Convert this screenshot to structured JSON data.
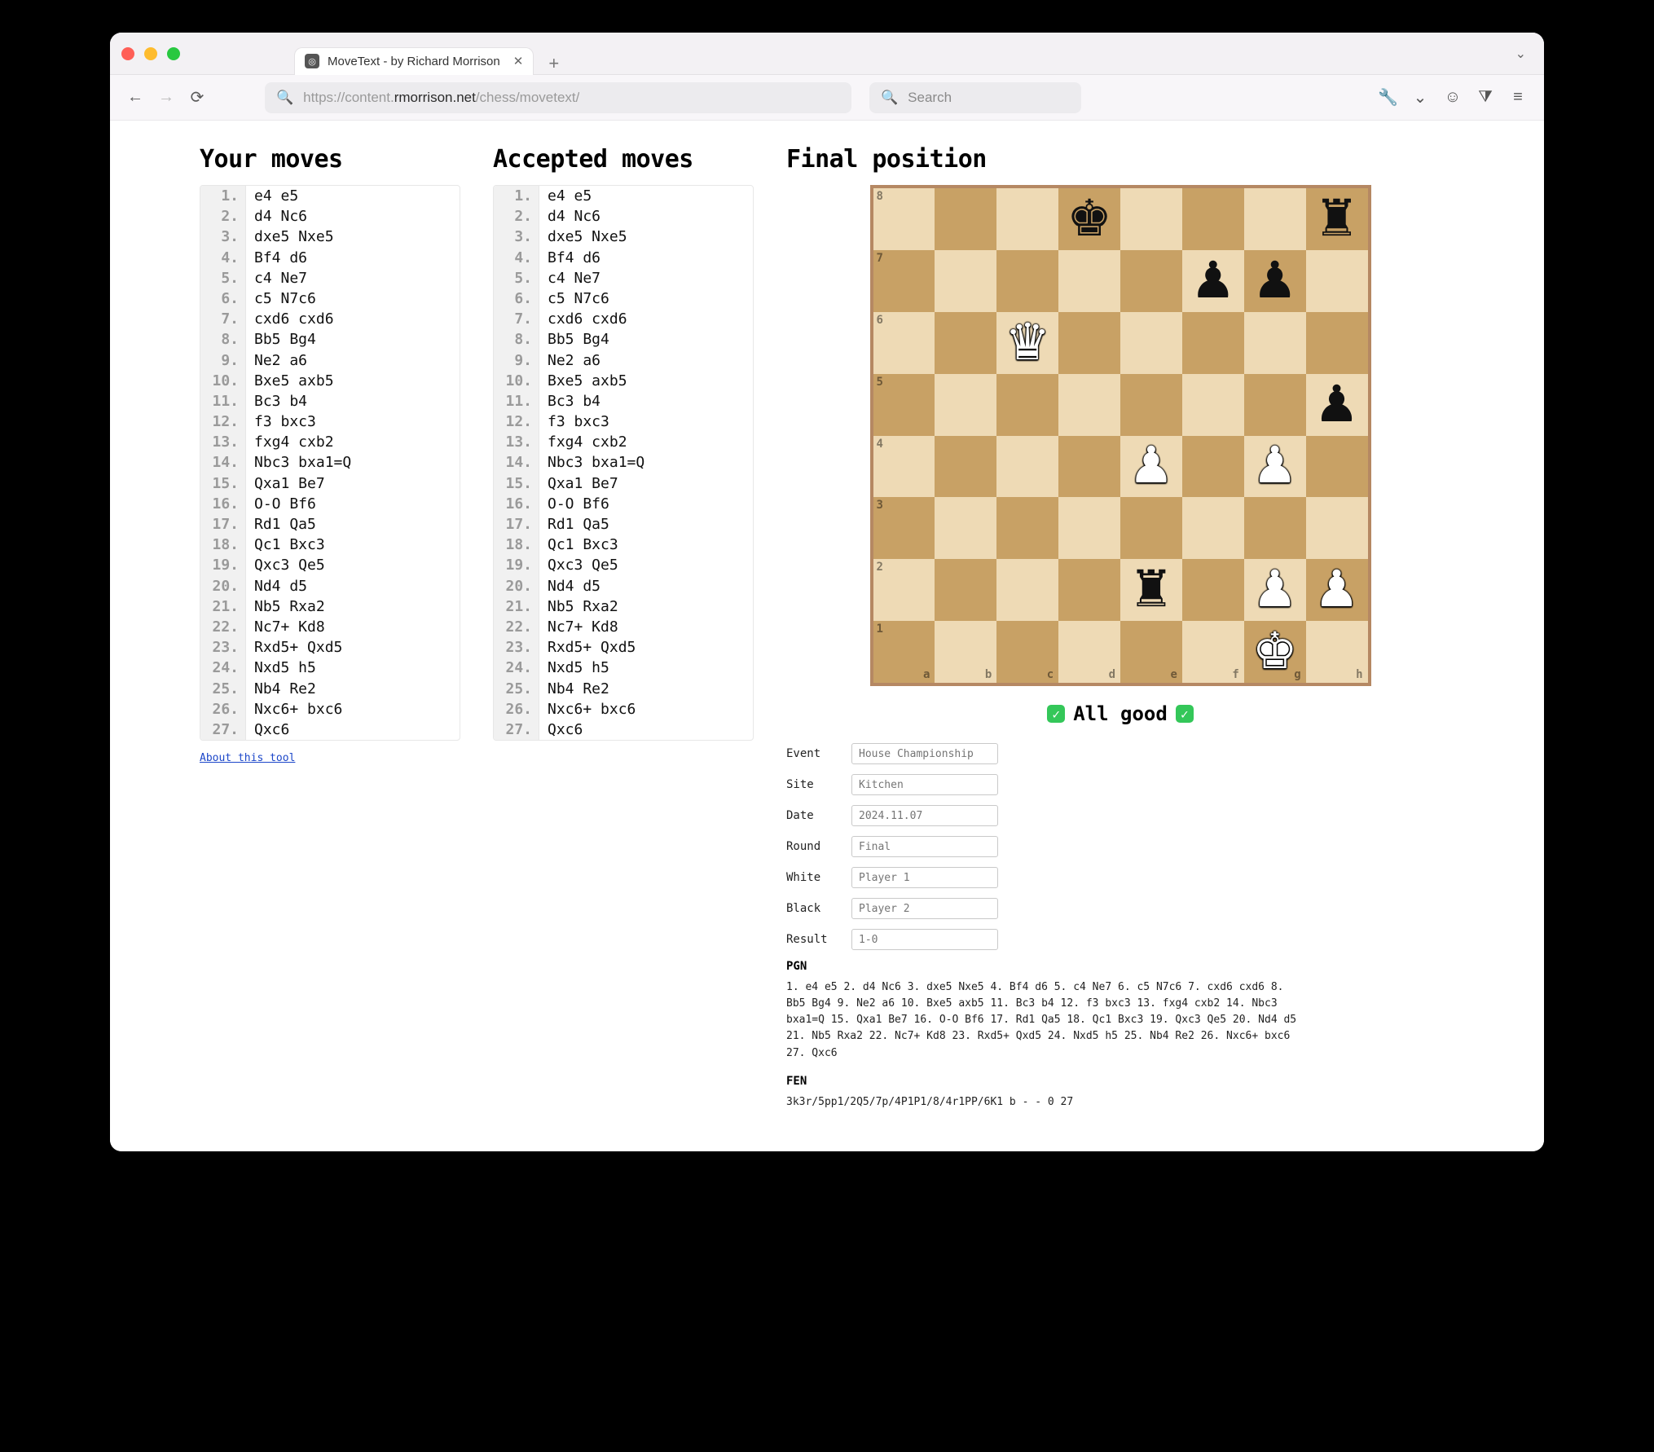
{
  "window": {
    "tab_title": "MoveText - by Richard Morrison",
    "url_grey_prefix": "https://content.",
    "url_dark": "rmorrison.net",
    "url_grey_suffix": "/chess/movetext/",
    "search_placeholder": "Search"
  },
  "headings": {
    "your_moves": "Your moves",
    "accepted_moves": "Accepted moves",
    "final_position": "Final position"
  },
  "moves": [
    {
      "n": "1.",
      "t": "e4 e5"
    },
    {
      "n": "2.",
      "t": "d4 Nc6"
    },
    {
      "n": "3.",
      "t": "dxe5 Nxe5"
    },
    {
      "n": "4.",
      "t": "Bf4 d6"
    },
    {
      "n": "5.",
      "t": "c4 Ne7"
    },
    {
      "n": "6.",
      "t": "c5 N7c6"
    },
    {
      "n": "7.",
      "t": "cxd6 cxd6"
    },
    {
      "n": "8.",
      "t": "Bb5 Bg4"
    },
    {
      "n": "9.",
      "t": "Ne2 a6"
    },
    {
      "n": "10.",
      "t": "Bxe5 axb5"
    },
    {
      "n": "11.",
      "t": "Bc3 b4"
    },
    {
      "n": "12.",
      "t": "f3 bxc3"
    },
    {
      "n": "13.",
      "t": "fxg4 cxb2"
    },
    {
      "n": "14.",
      "t": "Nbc3 bxa1=Q"
    },
    {
      "n": "15.",
      "t": "Qxa1 Be7"
    },
    {
      "n": "16.",
      "t": "O-O Bf6"
    },
    {
      "n": "17.",
      "t": "Rd1 Qa5"
    },
    {
      "n": "18.",
      "t": "Qc1 Bxc3"
    },
    {
      "n": "19.",
      "t": "Qxc3 Qe5"
    },
    {
      "n": "20.",
      "t": "Nd4 d5"
    },
    {
      "n": "21.",
      "t": "Nb5 Rxa2"
    },
    {
      "n": "22.",
      "t": "Nc7+ Kd8"
    },
    {
      "n": "23.",
      "t": "Rxd5+ Qxd5"
    },
    {
      "n": "24.",
      "t": "Nxd5 h5"
    },
    {
      "n": "25.",
      "t": "Nb4 Re2"
    },
    {
      "n": "26.",
      "t": "Nxc6+ bxc6"
    },
    {
      "n": "27.",
      "t": "Qxc6"
    }
  ],
  "about_link": "About this tool",
  "status": "All good",
  "meta_labels": {
    "event": "Event",
    "site": "Site",
    "date": "Date",
    "round": "Round",
    "white": "White",
    "black": "Black",
    "result": "Result"
  },
  "meta_placeholders": {
    "event": "House Championship",
    "site": "Kitchen",
    "date": "2024.11.07",
    "round": "Final",
    "white": "Player 1",
    "black": "Player 2",
    "result": "1-0"
  },
  "pgn_label": "PGN",
  "pgn_text": "1. e4 e5 2. d4 Nc6 3. dxe5 Nxe5 4. Bf4 d6 5. c4 Ne7 6. c5 N7c6 7. cxd6 cxd6 8. Bb5 Bg4 9. Ne2 a6 10. Bxe5 axb5 11. Bc3 b4 12. f3 bxc3 13. fxg4 cxb2 14. Nbc3 bxa1=Q 15. Qxa1 Be7 16. O-O Bf6 17. Rd1 Qa5 18. Qc1 Bxc3 19. Qxc3 Qe5 20. Nd4 d5 21. Nb5 Rxa2 22. Nc7+ Kd8 23. Rxd5+ Qxd5 24. Nxd5 h5 25. Nb4 Re2 26. Nxc6+ bxc6 27. Qxc6",
  "fen_label": "FEN",
  "fen_text": "3k3r/5pp1/2Q5/7p/4P1P1/8/4r1PP/6K1 b - - 0 27",
  "board": {
    "files": [
      "a",
      "b",
      "c",
      "d",
      "e",
      "f",
      "g",
      "h"
    ],
    "ranks": [
      "8",
      "7",
      "6",
      "5",
      "4",
      "3",
      "2",
      "1"
    ],
    "pieces": [
      {
        "sq": "d8",
        "color": "b",
        "glyph": "♚"
      },
      {
        "sq": "h8",
        "color": "b",
        "glyph": "♜"
      },
      {
        "sq": "f7",
        "color": "b",
        "glyph": "♟"
      },
      {
        "sq": "g7",
        "color": "b",
        "glyph": "♟"
      },
      {
        "sq": "c6",
        "color": "w",
        "glyph": "♛"
      },
      {
        "sq": "h5",
        "color": "b",
        "glyph": "♟"
      },
      {
        "sq": "e4",
        "color": "w",
        "glyph": "♟"
      },
      {
        "sq": "g4",
        "color": "w",
        "glyph": "♟"
      },
      {
        "sq": "e2",
        "color": "b",
        "glyph": "♜"
      },
      {
        "sq": "g2",
        "color": "w",
        "glyph": "♟"
      },
      {
        "sq": "h2",
        "color": "w",
        "glyph": "♟"
      },
      {
        "sq": "g1",
        "color": "w",
        "glyph": "♚"
      }
    ]
  },
  "chart_data": {
    "type": "table",
    "title": "Chess game final position",
    "fen": "3k3r/5pp1/2Q5/7p/4P1P1/8/4r1PP/6K1 b - - 0 27",
    "side_to_move": "black",
    "fullmove": 27,
    "pieces": [
      {
        "square": "d8",
        "piece": "king",
        "color": "black"
      },
      {
        "square": "h8",
        "piece": "rook",
        "color": "black"
      },
      {
        "square": "f7",
        "piece": "pawn",
        "color": "black"
      },
      {
        "square": "g7",
        "piece": "pawn",
        "color": "black"
      },
      {
        "square": "c6",
        "piece": "queen",
        "color": "white"
      },
      {
        "square": "h5",
        "piece": "pawn",
        "color": "black"
      },
      {
        "square": "e4",
        "piece": "pawn",
        "color": "white"
      },
      {
        "square": "g4",
        "piece": "pawn",
        "color": "white"
      },
      {
        "square": "e2",
        "piece": "rook",
        "color": "black"
      },
      {
        "square": "g2",
        "piece": "pawn",
        "color": "white"
      },
      {
        "square": "h2",
        "piece": "pawn",
        "color": "white"
      },
      {
        "square": "g1",
        "piece": "king",
        "color": "white"
      }
    ]
  }
}
